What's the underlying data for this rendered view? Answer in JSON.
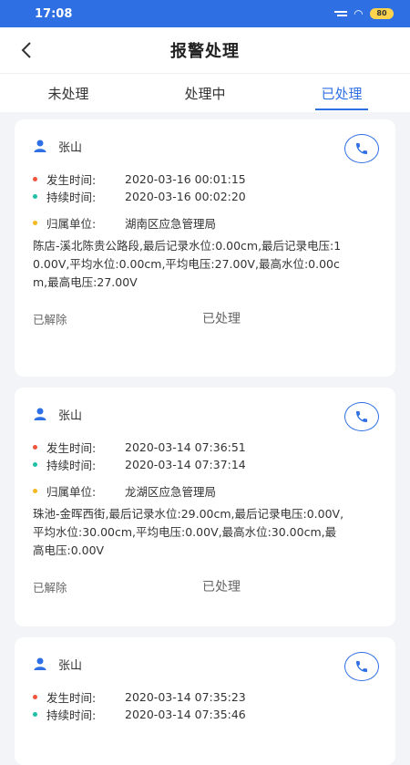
{
  "status_bar": {
    "time": "17:08",
    "battery": "80"
  },
  "nav": {
    "title": "报警处理"
  },
  "tabs": [
    {
      "label": "未处理"
    },
    {
      "label": "处理中"
    },
    {
      "label": "已处理"
    }
  ],
  "alarms": [
    {
      "name": "张山",
      "occur_label": "发生时间:",
      "occur_time": "2020-03-16  00:01:15",
      "duration_label": "持续时间:",
      "duration_time": "2020-03-16  00:02:20",
      "unit_label": "归属单位:",
      "unit": "湖南区应急管理局",
      "description": "陈店-溪北陈贵公路段,最后记录水位:0.00cm,最后记录电压:10.00V,平均水位:0.00cm,平均电压:27.00V,最高水位:0.00cm,最高电压:27.00V",
      "status_left": "已解除",
      "status_right": "已处理"
    },
    {
      "name": "张山",
      "occur_label": "发生时间:",
      "occur_time": "2020-03-14  07:36:51",
      "duration_label": "持续时间:",
      "duration_time": "2020-03-14  07:37:14",
      "unit_label": "归属单位:",
      "unit": "龙湖区应急管理局",
      "description": "珠池-金晖西街,最后记录水位:29.00cm,最后记录电压:0.00V,平均水位:30.00cm,平均电压:0.00V,最高水位:30.00cm,最高电压:0.00V",
      "status_left": "已解除",
      "status_right": "已处理"
    },
    {
      "name": "张山",
      "occur_label": "发生时间:",
      "occur_time": "2020-03-14  07:35:23",
      "duration_label": "持续时间:",
      "duration_time": "2020-03-14  07:35:46"
    }
  ]
}
